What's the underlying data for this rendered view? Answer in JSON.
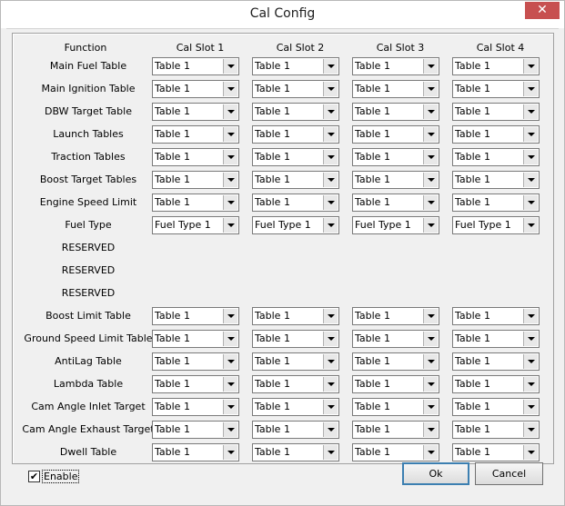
{
  "window": {
    "title": "Cal Config",
    "close_glyph": "✕"
  },
  "headers": {
    "function": "Function",
    "slots": [
      "Cal Slot 1",
      "Cal Slot 2",
      "Cal Slot 3",
      "Cal Slot 4"
    ]
  },
  "rows": [
    {
      "label": "Main Fuel Table",
      "values": [
        "Table 1",
        "Table 1",
        "Table 1",
        "Table 1"
      ]
    },
    {
      "label": "Main Ignition Table",
      "values": [
        "Table 1",
        "Table 1",
        "Table 1",
        "Table 1"
      ]
    },
    {
      "label": "DBW Target Table",
      "values": [
        "Table 1",
        "Table 1",
        "Table 1",
        "Table 1"
      ]
    },
    {
      "label": "Launch Tables",
      "values": [
        "Table 1",
        "Table 1",
        "Table 1",
        "Table 1"
      ]
    },
    {
      "label": "Traction Tables",
      "values": [
        "Table 1",
        "Table 1",
        "Table 1",
        "Table 1"
      ]
    },
    {
      "label": "Boost Target Tables",
      "values": [
        "Table 1",
        "Table 1",
        "Table 1",
        "Table 1"
      ]
    },
    {
      "label": "Engine Speed Limit",
      "values": [
        "Table 1",
        "Table 1",
        "Table 1",
        "Table 1"
      ]
    },
    {
      "label": "Fuel Type",
      "values": [
        "Fuel Type 1",
        "Fuel Type 1",
        "Fuel Type 1",
        "Fuel Type 1"
      ]
    },
    {
      "label": "RESERVED",
      "values": null
    },
    {
      "label": "RESERVED",
      "values": null
    },
    {
      "label": "RESERVED",
      "values": null
    },
    {
      "label": "Boost Limit Table",
      "values": [
        "Table 1",
        "Table 1",
        "Table 1",
        "Table 1"
      ]
    },
    {
      "label": "Ground Speed Limit Table",
      "values": [
        "Table 1",
        "Table 1",
        "Table 1",
        "Table 1"
      ]
    },
    {
      "label": "AntiLag Table",
      "values": [
        "Table 1",
        "Table 1",
        "Table 1",
        "Table 1"
      ]
    },
    {
      "label": "Lambda Table",
      "values": [
        "Table 1",
        "Table 1",
        "Table 1",
        "Table 1"
      ]
    },
    {
      "label": "Cam Angle Inlet Target",
      "values": [
        "Table 1",
        "Table 1",
        "Table 1",
        "Table 1"
      ]
    },
    {
      "label": "Cam Angle Exhaust Target",
      "values": [
        "Table 1",
        "Table 1",
        "Table 1",
        "Table 1"
      ]
    },
    {
      "label": "Dwell Table",
      "values": [
        "Table 1",
        "Table 1",
        "Table 1",
        "Table 1"
      ]
    }
  ],
  "enable": {
    "label": "Enable",
    "checked": true,
    "check_glyph": "✔"
  },
  "buttons": {
    "ok": "Ok",
    "cancel": "Cancel"
  }
}
